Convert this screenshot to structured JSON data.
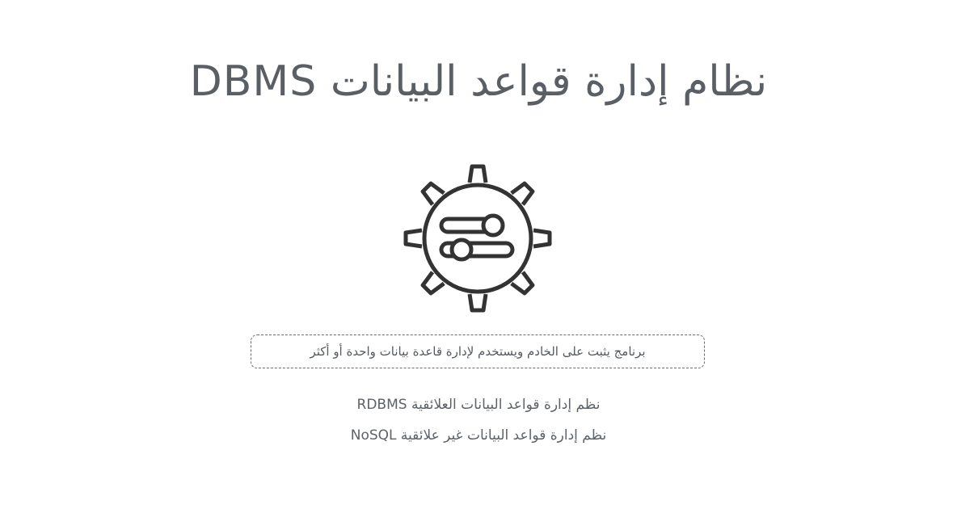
{
  "title": "نظام إدارة قواعد البيانات  DBMS",
  "icon": "gear-sliders-icon",
  "definition": "برنامج يثبت على الخادم ويستخدم لإدارة قاعدة بيانات واحدة أو أكثر",
  "types": [
    {
      "label": "نظم إدارة قواعد البيانات العلائقية RDBMS"
    },
    {
      "label": "نظم إدارة قواعد البيانات غير علائقية NoSQL"
    }
  ],
  "colors": {
    "title": "#5a5f66",
    "icon_stroke": "#333333",
    "text": "#5d6268",
    "border": "#6b6b6b"
  }
}
